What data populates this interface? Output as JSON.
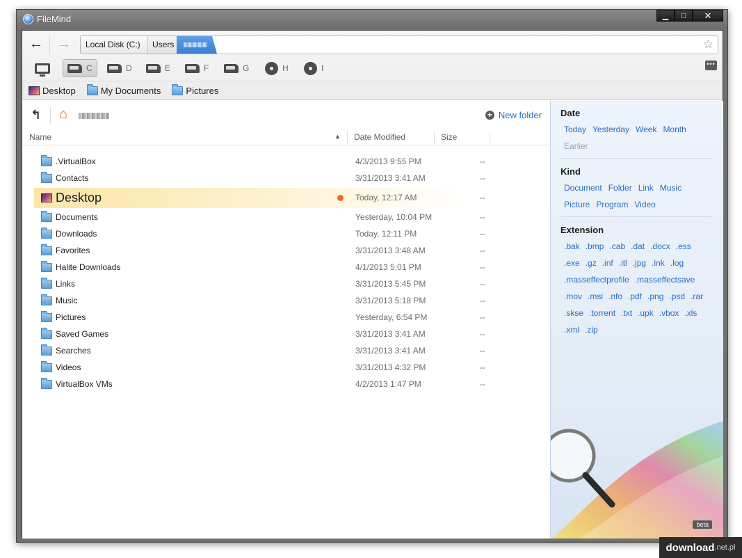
{
  "window": {
    "title": "FileMind",
    "buttons": {
      "minimize": "▁",
      "maximize": "□",
      "close": "✕"
    }
  },
  "navigation": {
    "back_icon": "back-arrow-icon",
    "forward_icon": "forward-arrow-icon",
    "breadcrumbs": [
      "Local Disk (C:)",
      "Users"
    ]
  },
  "drives": [
    {
      "label": "",
      "icon": "computer-icon"
    },
    {
      "label": "C",
      "icon": "hard-drive-icon"
    },
    {
      "label": "D",
      "icon": "hard-drive-icon"
    },
    {
      "label": "E",
      "icon": "hard-drive-icon"
    },
    {
      "label": "F",
      "icon": "hard-drive-icon"
    },
    {
      "label": "G",
      "icon": "hard-drive-icon"
    },
    {
      "label": "H",
      "icon": "cd-drive-icon"
    },
    {
      "label": "I",
      "icon": "cd-drive-icon"
    }
  ],
  "favorites": [
    "Desktop",
    "My Documents",
    "Pictures"
  ],
  "filepane": {
    "new_folder": "New folder",
    "columns": {
      "name": "Name",
      "date": "Date Modified",
      "size": "Size"
    },
    "files": [
      {
        "name": ".VirtualBox",
        "date": "4/3/2013 9:55 PM",
        "size": "--"
      },
      {
        "name": "Contacts",
        "date": "3/31/2013 3:41 AM",
        "size": "--"
      },
      {
        "name": "Desktop",
        "date": "Today, 12:17 AM",
        "size": "--"
      },
      {
        "name": "Documents",
        "date": "Yesterday, 10:04 PM",
        "size": "--"
      },
      {
        "name": "Downloads",
        "date": "Today, 12:11 PM",
        "size": "--"
      },
      {
        "name": "Favorites",
        "date": "3/31/2013 3:48 AM",
        "size": "--"
      },
      {
        "name": "Halite Downloads",
        "date": "4/1/2013 5:01 PM",
        "size": "--"
      },
      {
        "name": "Links",
        "date": "3/31/2013 5:45 PM",
        "size": "--"
      },
      {
        "name": "Music",
        "date": "3/31/2013 5:18 PM",
        "size": "--"
      },
      {
        "name": "Pictures",
        "date": "Yesterday, 6:54 PM",
        "size": "--"
      },
      {
        "name": "Saved Games",
        "date": "3/31/2013 3:41 AM",
        "size": "--"
      },
      {
        "name": "Searches",
        "date": "3/31/2013 3:41 AM",
        "size": "--"
      },
      {
        "name": "Videos",
        "date": "3/31/2013 4:32 PM",
        "size": "--"
      },
      {
        "name": "VirtualBox VMs",
        "date": "4/2/2013 1:47 PM",
        "size": "--"
      }
    ]
  },
  "filters": {
    "date_title": "Date",
    "date_items": [
      "Today",
      "Yesterday",
      "Week",
      "Month"
    ],
    "date_disabled": "Earlier",
    "kind_title": "Kind",
    "kind_row1": [
      "Document",
      "Folder",
      "Link",
      "Music"
    ],
    "kind_row2": [
      "Picture",
      "Program",
      "Video"
    ],
    "ext_title": "Extension",
    "ext_rows": [
      [
        ".bak",
        ".bmp",
        ".cab",
        ".dat",
        ".docx",
        ".ess"
      ],
      [
        ".exe",
        ".gz",
        ".inf",
        ".itl",
        ".jpg",
        ".lnk",
        ".log"
      ],
      [
        ".masseffectprofile",
        ".masseffectsave"
      ],
      [
        ".mov",
        ".msi",
        ".nfo",
        ".pdf",
        ".png",
        ".psd",
        ".rar"
      ],
      [
        ".skse",
        ".torrent",
        ".txt",
        ".upk",
        ".vbox",
        ".xls"
      ],
      [
        ".xml",
        ".zip"
      ]
    ],
    "beta": "beta"
  },
  "watermark": {
    "main": "download",
    "suffix": ".net.pl"
  }
}
